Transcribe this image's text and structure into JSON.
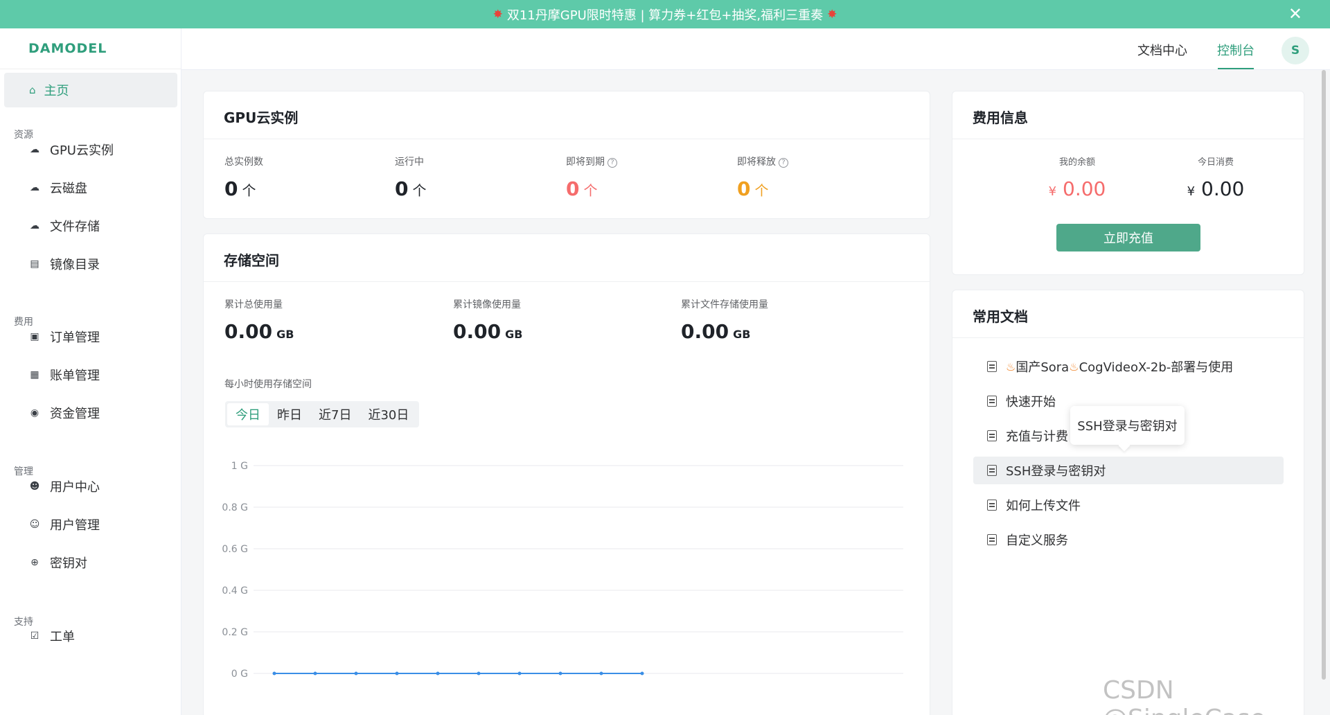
{
  "banner": {
    "text": "双11丹摩GPU限时特惠 | 算力券+红包+抽奖,福利三重奏",
    "close": "✕"
  },
  "logo": "DAMODEL",
  "header": {
    "docs": "文档中心",
    "console": "控制台",
    "avatar": "S"
  },
  "sidebar": {
    "home": "主页",
    "groups": [
      {
        "label": "资源",
        "items": [
          {
            "label": "GPU云实例",
            "icon": "cloud-icon"
          },
          {
            "label": "云磁盘",
            "icon": "cloud-disk-icon"
          },
          {
            "label": "文件存储",
            "icon": "cloud-storage-icon"
          },
          {
            "label": "镜像目录",
            "icon": "image-catalog-icon"
          }
        ]
      },
      {
        "label": "费用",
        "items": [
          {
            "label": "订单管理",
            "icon": "order-icon"
          },
          {
            "label": "账单管理",
            "icon": "bill-icon"
          },
          {
            "label": "资金管理",
            "icon": "funds-icon"
          }
        ]
      },
      {
        "label": "管理",
        "items": [
          {
            "label": "用户中心",
            "icon": "users-icon"
          },
          {
            "label": "用户管理",
            "icon": "user-settings-icon"
          },
          {
            "label": "密钥对",
            "icon": "lock-icon"
          }
        ]
      },
      {
        "label": "支持",
        "items": [
          {
            "label": "工单",
            "icon": "ticket-icon"
          }
        ]
      }
    ]
  },
  "gpu": {
    "title": "GPU云实例",
    "stats": [
      {
        "label": "总实例数",
        "value": "0",
        "unit": "个",
        "color": "#1f2329",
        "help": false
      },
      {
        "label": "运行中",
        "value": "0",
        "unit": "个",
        "color": "#1f2329",
        "help": false
      },
      {
        "label": "即将到期",
        "value": "0",
        "unit": "个",
        "color": "#f56c6c",
        "help": true
      },
      {
        "label": "即将释放",
        "value": "0",
        "unit": "个",
        "color": "#f0a020",
        "help": true
      }
    ]
  },
  "storage": {
    "title": "存储空间",
    "stats": [
      {
        "label": "累计总使用量",
        "value": "0.00",
        "unit": "GB"
      },
      {
        "label": "累计镜像使用量",
        "value": "0.00",
        "unit": "GB"
      },
      {
        "label": "累计文件存储使用量",
        "value": "0.00",
        "unit": "GB"
      }
    ],
    "hourly_label": "每小时使用存储空间",
    "tabs": [
      "今日",
      "昨日",
      "近7日",
      "近30日"
    ],
    "active_tab": 0
  },
  "chart_data": {
    "type": "line",
    "yticks": [
      "1 G",
      "0.8 G",
      "0.6 G",
      "0.4 G",
      "0.2 G",
      "0 G"
    ],
    "ylim": [
      0,
      1
    ],
    "series": [
      {
        "values": [
          0,
          0,
          0,
          0,
          0,
          0,
          0,
          0,
          0,
          0
        ],
        "color": "#3a8ee6"
      }
    ],
    "grid": true
  },
  "billing": {
    "title": "费用信息",
    "balance_label": "我的余额",
    "balance_currency": "¥",
    "balance_value": "0.00",
    "today_label": "今日消费",
    "today_currency": "¥",
    "today_value": "0.00",
    "recharge": "立即充值"
  },
  "docs": {
    "title": "常用文档",
    "items": [
      {
        "pre": "国产Sora",
        "post": "CogVideoX-2b-部署与使用",
        "fire": true
      },
      {
        "label": "快速开始"
      },
      {
        "label": "充值与计费"
      },
      {
        "label": "SSH登录与密钥对"
      },
      {
        "label": "如何上传文件"
      },
      {
        "label": "自定义服务"
      }
    ],
    "tooltip": "SSH登录与密钥对"
  },
  "watermark": "CSDN @SingleCase"
}
